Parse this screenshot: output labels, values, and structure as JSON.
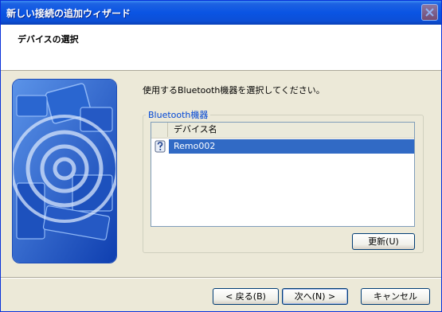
{
  "window": {
    "title": "新しい接続の追加ウィザード"
  },
  "header": {
    "title": "デバイスの選択"
  },
  "main": {
    "instruction": "使用するBluetooth機器を選択してください。",
    "group_label": "Bluetooth機器",
    "list": {
      "column_header": "デバイス名",
      "rows": [
        {
          "name": "Remo002",
          "icon": "unknown-device-icon",
          "selected": true
        }
      ]
    },
    "refresh_button": "更新(U)"
  },
  "footer": {
    "back_button": "< 戻る(B)",
    "next_button": "次へ(N) >",
    "cancel_button": "キャンセル"
  },
  "colors": {
    "titlebar": "#0a54e3",
    "selection": "#316ac5",
    "group_label": "#0046d5"
  }
}
